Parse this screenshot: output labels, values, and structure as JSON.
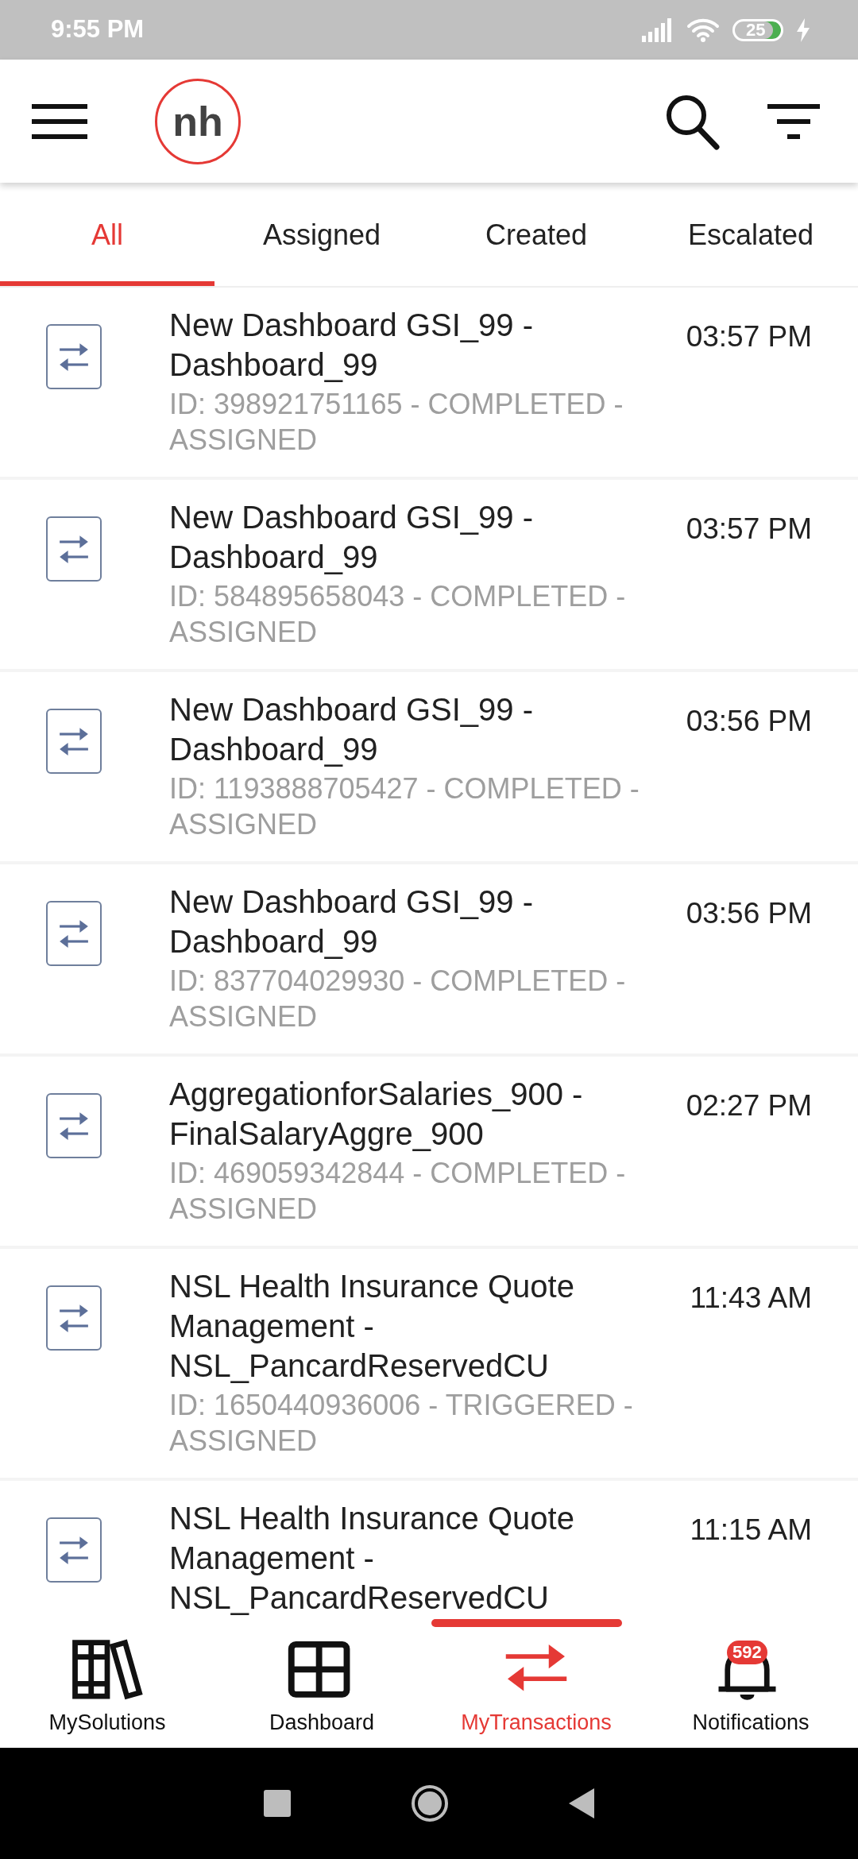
{
  "status_bar": {
    "time": "9:55 PM",
    "battery": "25"
  },
  "header": {
    "logo": "nh"
  },
  "tabs": [
    {
      "label": "All",
      "selected": true
    },
    {
      "label": "Assigned",
      "selected": false
    },
    {
      "label": "Created",
      "selected": false
    },
    {
      "label": "Escalated",
      "selected": false
    }
  ],
  "transactions": [
    {
      "title": "New Dashboard GSI_99 - Dashboard_99",
      "details": "ID: 398921751165 - COMPLETED - ASSIGNED",
      "time": "03:57 PM"
    },
    {
      "title": "New Dashboard GSI_99 - Dashboard_99",
      "details": "ID: 584895658043 - COMPLETED - ASSIGNED",
      "time": "03:57 PM"
    },
    {
      "title": "New Dashboard GSI_99 - Dashboard_99",
      "details": "ID: 1193888705427 - COMPLETED - ASSIGNED",
      "time": "03:56 PM"
    },
    {
      "title": "New Dashboard GSI_99 - Dashboard_99",
      "details": "ID: 837704029930 - COMPLETED - ASSIGNED",
      "time": "03:56 PM"
    },
    {
      "title": "AggregationforSalaries_900 - FinalSalaryAggre_900",
      "details": "ID: 469059342844 - COMPLETED - ASSIGNED",
      "time": "02:27 PM"
    },
    {
      "title": "NSL Health Insurance Quote Management - NSL_PancardReservedCU",
      "details": "ID: 1650440936006 - TRIGGERED - ASSIGNED",
      "time": "11:43 AM"
    },
    {
      "title": "NSL Health Insurance Quote Management - NSL_PancardReservedCU",
      "time": "11:15 AM"
    }
  ],
  "bottom_nav": [
    {
      "kind": "solutions",
      "label": "MySolutions",
      "selected": false
    },
    {
      "kind": "dashboard",
      "label": "Dashboard",
      "selected": false
    },
    {
      "kind": "transactions",
      "label": "MyTransactions",
      "selected": true
    },
    {
      "kind": "notifications",
      "label": "Notifications",
      "selected": false,
      "badge": "592"
    }
  ]
}
